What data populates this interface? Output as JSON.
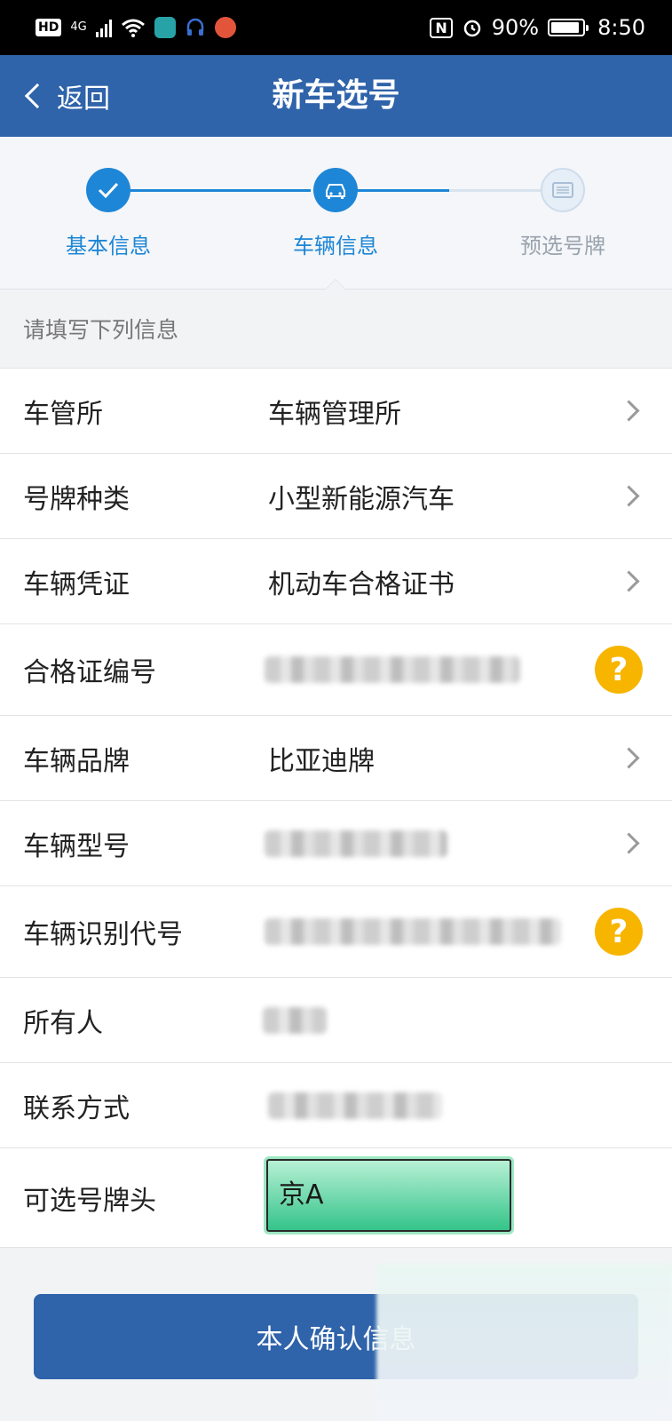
{
  "status_bar": {
    "hd": "HD",
    "network": "4G",
    "battery": "90%",
    "time": "8:50",
    "nfc": "N"
  },
  "header": {
    "back_label": "返回",
    "title": "新车选号"
  },
  "steps": [
    {
      "label": "基本信息",
      "state": "done"
    },
    {
      "label": "车辆信息",
      "state": "active"
    },
    {
      "label": "预选号牌",
      "state": "pending"
    }
  ],
  "section_label": "请填写下列信息",
  "form": {
    "dmv": {
      "label": "车管所",
      "value": "车辆管理所"
    },
    "plate_type": {
      "label": "号牌种类",
      "value": "小型新能源汽车"
    },
    "vehicle_cert": {
      "label": "车辆凭证",
      "value": "机动车合格证书"
    },
    "cert_number": {
      "label": "合格证编号",
      "value": ""
    },
    "brand": {
      "label": "车辆品牌",
      "value": "比亚迪牌"
    },
    "model": {
      "label": "车辆型号",
      "value": ""
    },
    "vin": {
      "label": "车辆识别代号",
      "value": ""
    },
    "owner": {
      "label": "所有人",
      "value": ""
    },
    "contact": {
      "label": "联系方式",
      "value": ""
    },
    "plate_prefix": {
      "label": "可选号牌头",
      "value": "京A"
    }
  },
  "confirm_button": "本人确认信息",
  "colors": {
    "primary": "#2f63aa",
    "step_active": "#1e86d6",
    "help": "#f7b500",
    "plate_green": "#34c48a"
  },
  "icons": {
    "help": "?"
  }
}
